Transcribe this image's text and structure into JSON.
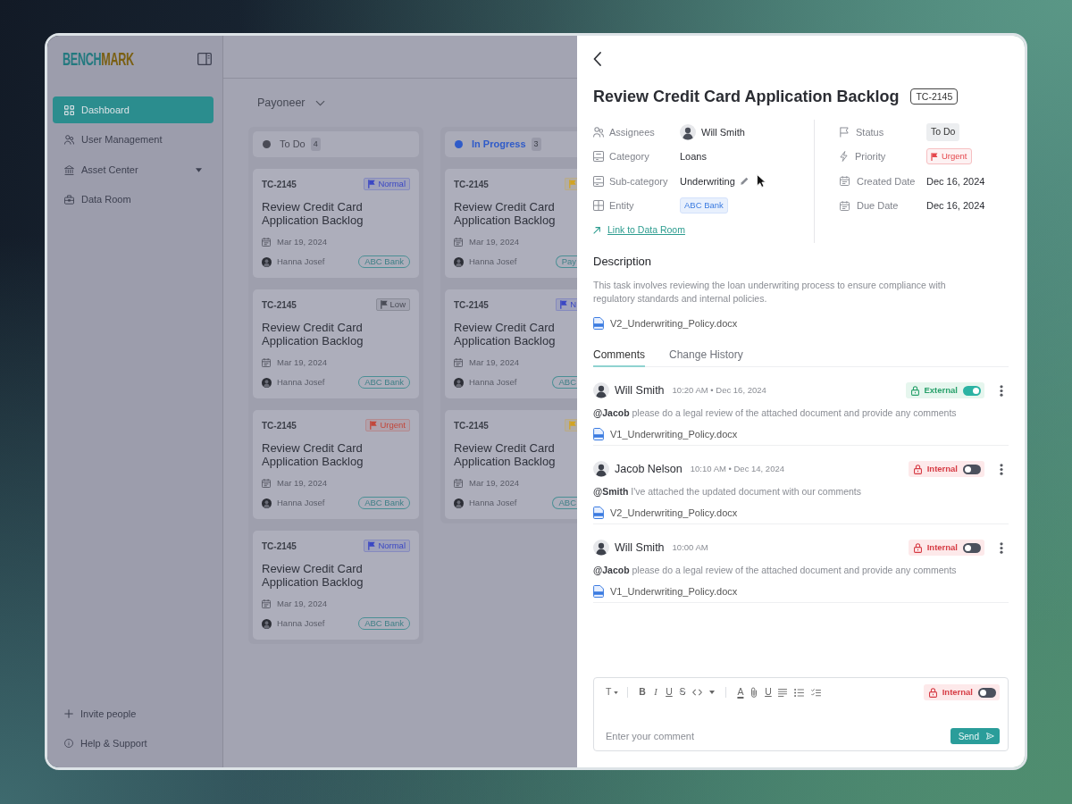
{
  "sidebar": {
    "logo": {
      "lead": "BENCH",
      "tail": "MARK"
    },
    "items": [
      {
        "label": "Dashboard",
        "kind": "link",
        "selected": true
      },
      {
        "label": "User Management",
        "kind": "link",
        "selected": false
      },
      {
        "label": "Asset Center",
        "kind": "group",
        "selected": false
      },
      {
        "label": "Data Room",
        "kind": "link",
        "selected": false
      }
    ],
    "footer": [
      {
        "label": "Invite people"
      },
      {
        "label": "Help & Support"
      }
    ]
  },
  "board": {
    "workspace": "Payoneer",
    "columns": [
      {
        "title": "To Do",
        "count": "4",
        "color": "#4a4b56",
        "cards": [
          {
            "id": "TC-2145",
            "priority": {
              "label": "Normal",
              "color": "#3a47c4"
            },
            "title": "Review Credit Card Application Backlog",
            "date": "Mar 19, 2024",
            "assignee": "Hanna Josef",
            "tag": "ABC Bank"
          },
          {
            "id": "TC-2145",
            "priority": {
              "label": "Low",
              "color": "#4a4c57"
            },
            "title": "Review Credit Card Application Backlog",
            "date": "Mar 19, 2024",
            "assignee": "Hanna Josef",
            "tag": "ABC Bank"
          },
          {
            "id": "TC-2145",
            "priority": {
              "label": "Urgent",
              "color": "#c2473b"
            },
            "title": "Review Credit Card Application Backlog",
            "date": "Mar 19, 2024",
            "assignee": "Hanna Josef",
            "tag": "ABC Bank"
          },
          {
            "id": "TC-2145",
            "priority": {
              "label": "Normal",
              "color": "#3a47c4"
            },
            "title": "Review Credit Card Application Backlog",
            "date": "Mar 19, 2024",
            "assignee": "Hanna Josef",
            "tag": "ABC Bank"
          }
        ]
      },
      {
        "title": "In Progress",
        "count": "3",
        "color": "#2f5bc9",
        "cards": [
          {
            "id": "TC-2145",
            "priority": {
              "color": "#d2a424"
            },
            "title": "Review Credit Card Application Backlog",
            "date": "Mar 19, 2024",
            "assignee": "Hanna Josef",
            "tag": "Pay"
          },
          {
            "id": "TC-2145",
            "priority": {
              "label": "N",
              "color": "#3a47c4"
            },
            "title": "Review Credit Card Application Backlog",
            "date": "Mar 19, 2024",
            "assignee": "Hanna Josef",
            "tag": "ABC"
          },
          {
            "id": "TC-2145",
            "priority": {
              "color": "#d2a424"
            },
            "title": "Review Credit Card Application Backlog",
            "date": "Mar 19, 2024",
            "assignee": "Hanna Josef",
            "tag": "ABC"
          }
        ]
      }
    ]
  },
  "detail": {
    "title": "Review Credit Card Application Backlog",
    "id": "TC-2145",
    "fields_left": [
      {
        "label": "Assignees",
        "kind": "person",
        "value": "Will Smith"
      },
      {
        "label": "Category",
        "kind": "text",
        "value": "Loans"
      },
      {
        "label": "Sub-category",
        "kind": "editable",
        "value": "Underwriting"
      },
      {
        "label": "Entity",
        "kind": "tag",
        "value": "ABC Bank"
      }
    ],
    "link": "Link to Data Room",
    "fields_right": [
      {
        "label": "Status",
        "kind": "status",
        "value": "To Do"
      },
      {
        "label": "Priority",
        "kind": "priority",
        "value": "Urgent",
        "color": "#e5484d"
      },
      {
        "label": "Created Date",
        "kind": "text",
        "value": "Dec 16, 2024"
      },
      {
        "label": "Due Date",
        "kind": "text",
        "value": "Dec 16, 2024"
      }
    ],
    "description": {
      "heading": "Description",
      "text": "This task involves reviewing the loan underwriting process to ensure compliance with regulatory standards and internal policies.",
      "attachment": "V2_Underwriting_Policy.docx"
    },
    "tabs": [
      {
        "label": "Comments",
        "selected": true
      },
      {
        "label": "Change History",
        "selected": false
      }
    ],
    "comments": [
      {
        "author": "Will Smith",
        "time": "10:20 AM • Dec 16, 2024",
        "visibility": "External",
        "on": true,
        "text": "**@Jacob** please do a legal review of the attached document and provide any comments",
        "attachment": "V1_Underwriting_Policy.docx"
      },
      {
        "author": "Jacob Nelson",
        "time": "10:10 AM • Dec 14, 2024",
        "visibility": "Internal",
        "on": false,
        "text": "**@Smith** I've attached the updated document with our comments",
        "attachment": "V2_Underwriting_Policy.docx"
      },
      {
        "author": "Will Smith",
        "time": "10:00 AM",
        "visibility": "Internal",
        "on": false,
        "text": "**@Jacob** please do a legal review of the attached document and provide any comments",
        "attachment": "V1_Underwriting_Policy.docx"
      }
    ],
    "editor": {
      "toolbar": [
        {
          "kind": "size",
          "label": "T"
        },
        {
          "kind": "divider"
        },
        {
          "kind": "bold",
          "label": "B"
        },
        {
          "kind": "italic",
          "label": "I"
        },
        {
          "kind": "underline",
          "label": "U"
        },
        {
          "kind": "strike",
          "label": "S"
        },
        {
          "kind": "code"
        },
        {
          "kind": "more"
        },
        {
          "kind": "divider"
        },
        {
          "kind": "color",
          "label": "A"
        },
        {
          "kind": "attach"
        },
        {
          "kind": "underline",
          "label": "U"
        },
        {
          "kind": "align"
        },
        {
          "kind": "bullets"
        },
        {
          "kind": "checklist"
        }
      ],
      "visibility": "Internal",
      "on": false,
      "placeholder": "Enter your comment",
      "send": "Send"
    }
  }
}
